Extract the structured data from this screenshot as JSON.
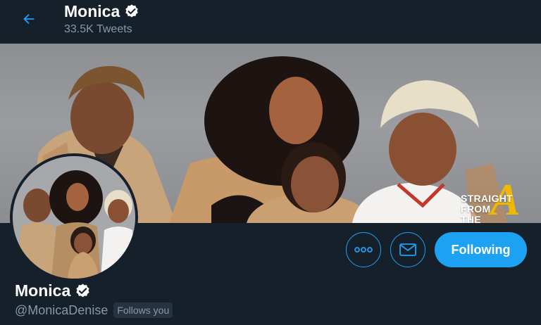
{
  "header": {
    "back_icon": "arrow-left-icon",
    "name": "Monica",
    "verified_icon": "verified-badge-icon",
    "tweet_count": "33.5K Tweets"
  },
  "banner": {
    "watermark_lines": [
      "STRAIGHT",
      "FROM",
      "THE"
    ],
    "watermark_letter": "A",
    "watermark_color": "#f0b800"
  },
  "actions": {
    "more_icon": "more-horizontal-icon",
    "message_icon": "envelope-icon",
    "follow_label": "Following"
  },
  "profile": {
    "name": "Monica",
    "handle": "@MonicaDenise",
    "follows_you": "Follows you"
  },
  "colors": {
    "background": "#15202b",
    "accent": "#1da1f2",
    "secondary_text": "#8899a6",
    "badge_bg": "#253341"
  }
}
